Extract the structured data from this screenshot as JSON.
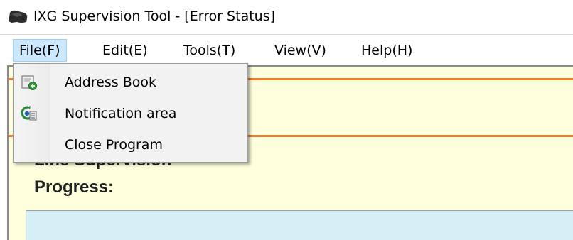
{
  "window": {
    "title": "IXG Supervision Tool - [Error Status]",
    "app_icon": "app-logo-icon"
  },
  "menubar": {
    "items": [
      {
        "label": "File(F)",
        "active": true
      },
      {
        "label": "Edit(E)",
        "active": false
      },
      {
        "label": "Tools(T)",
        "active": false
      },
      {
        "label": "View(V)",
        "active": false
      },
      {
        "label": "Help(H)",
        "active": false
      }
    ]
  },
  "file_menu": {
    "items": [
      {
        "label": "Address Book",
        "icon": "address-book-icon"
      },
      {
        "label": "Notification area",
        "icon": "notification-area-icon"
      },
      {
        "label": "Close Program",
        "icon": ""
      }
    ]
  },
  "content": {
    "line_supervision_label": "Line Supervision",
    "progress_label": "Progress:"
  },
  "colors": {
    "content_background": "#ffffdd",
    "accent_line": "#ed7d31",
    "progress_box": "#d6eef5",
    "menu_active_background": "#cce8ff",
    "menu_active_border": "#99d1ff",
    "dropdown_background": "#f2f2f2"
  }
}
